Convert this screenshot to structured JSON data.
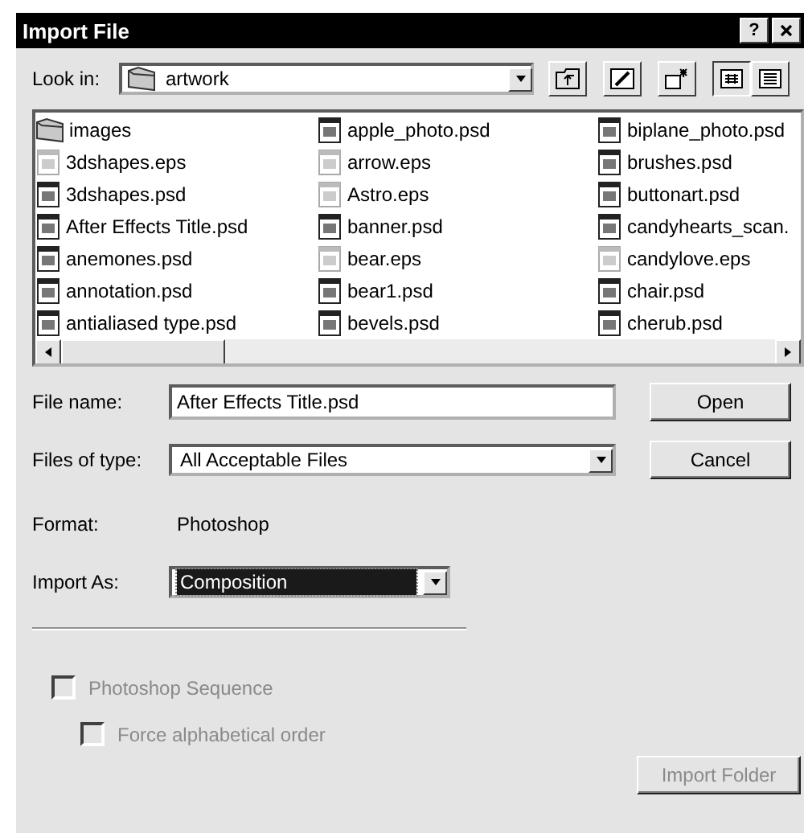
{
  "window": {
    "title": "Import File",
    "help_button": "?"
  },
  "look_in": {
    "label": "Look in:",
    "value": "artwork"
  },
  "files": [
    {
      "name": "images",
      "kind": "folder",
      "selected": false
    },
    {
      "name": "3dshapes.eps",
      "kind": "eps",
      "selected": false
    },
    {
      "name": "3dshapes.psd",
      "kind": "psd",
      "selected": false
    },
    {
      "name": "After Effects Title.psd",
      "kind": "psd",
      "selected": false
    },
    {
      "name": "anemones.psd",
      "kind": "psd",
      "selected": false
    },
    {
      "name": "annotation.psd",
      "kind": "psd",
      "selected": false
    },
    {
      "name": "antialiased type.psd",
      "kind": "psd",
      "selected": false
    },
    {
      "name": "apple_photo.psd",
      "kind": "psd",
      "selected": false
    },
    {
      "name": "arrow.eps",
      "kind": "eps",
      "selected": false
    },
    {
      "name": "Astro.eps",
      "kind": "eps",
      "selected": false
    },
    {
      "name": "banner.psd",
      "kind": "psd",
      "selected": false
    },
    {
      "name": "bear.eps",
      "kind": "eps",
      "selected": false
    },
    {
      "name": "bear1.psd",
      "kind": "psd",
      "selected": false
    },
    {
      "name": "bevels.psd",
      "kind": "psd",
      "selected": false
    },
    {
      "name": "biplane_photo.psd",
      "kind": "psd",
      "selected": false
    },
    {
      "name": "brushes.psd",
      "kind": "psd",
      "selected": false
    },
    {
      "name": "buttonart.psd",
      "kind": "psd",
      "selected": false
    },
    {
      "name": "candyhearts_scan.",
      "kind": "psd",
      "selected": false
    },
    {
      "name": "candylove.eps",
      "kind": "eps",
      "selected": false
    },
    {
      "name": "chair.psd",
      "kind": "psd",
      "selected": false
    },
    {
      "name": "cherub.psd",
      "kind": "psd",
      "selected": false
    }
  ],
  "file_name": {
    "label": "File name:",
    "value": "After Effects Title.psd"
  },
  "files_of_type": {
    "label": "Files of type:",
    "value": "All Acceptable Files"
  },
  "buttons": [
    {
      "label": "Open",
      "disabled": false
    },
    {
      "label": "Cancel",
      "disabled": false
    }
  ],
  "format": {
    "label": "Format:",
    "value": "Photoshop"
  },
  "import_as": {
    "label": "Import As:",
    "value": "Composition",
    "focused": true
  },
  "options": [
    {
      "label": "Photoshop Sequence",
      "checked": false,
      "disabled": true,
      "children": [
        {
          "label": "Force alphabetical order",
          "checked": false,
          "disabled": true
        }
      ]
    }
  ],
  "import_folder": {
    "label": "Import Folder",
    "disabled": true
  }
}
